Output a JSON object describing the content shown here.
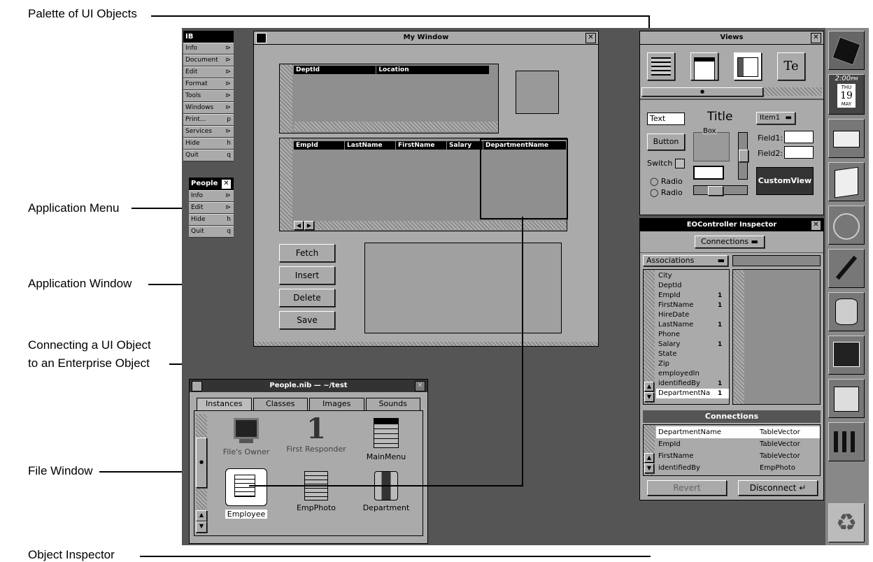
{
  "callouts": {
    "palette": "Palette of UI Objects",
    "app_menu": "Application Menu",
    "app_window": "Application Window",
    "connecting_line1": "Connecting a UI Object",
    "connecting_line2": "to an Enterprise Object",
    "file_window": "File Window",
    "object_inspector": "Object Inspector"
  },
  "ib_menu": {
    "title": "IB",
    "items": [
      {
        "label": "Info",
        "key": "⊳"
      },
      {
        "label": "Document",
        "key": "⊳"
      },
      {
        "label": "Edit",
        "key": "⊳"
      },
      {
        "label": "Format",
        "key": "⊳"
      },
      {
        "label": "Tools",
        "key": "⊳"
      },
      {
        "label": "Windows",
        "key": "⊳"
      },
      {
        "label": "Print...",
        "key": "p"
      },
      {
        "label": "Services",
        "key": "⊳"
      },
      {
        "label": "Hide",
        "key": "h"
      },
      {
        "label": "Quit",
        "key": "q"
      }
    ]
  },
  "people_menu": {
    "title": "People",
    "items": [
      {
        "label": "Info",
        "key": "⊳"
      },
      {
        "label": "Edit",
        "key": "⊳"
      },
      {
        "label": "Hide",
        "key": "h"
      },
      {
        "label": "Quit",
        "key": "q"
      }
    ]
  },
  "my_window": {
    "title": "My Window",
    "table1_cols": [
      "DeptId",
      "Location"
    ],
    "table2_cols": [
      "EmpId",
      "LastName",
      "FirstName",
      "Salary",
      "DepartmentName"
    ],
    "buttons": [
      "Fetch",
      "Insert",
      "Delete",
      "Save"
    ]
  },
  "views": {
    "title": "Views",
    "icon_text": "Te",
    "text_field": "Text",
    "title_label": "Title",
    "popup": "Item1",
    "box_label": "Box",
    "field1": "Field1:",
    "field2": "Field2:",
    "button": "Button",
    "switch": "Switch",
    "radio1": "Radio",
    "radio2": "Radio",
    "custom": "CustomView"
  },
  "inspector": {
    "title": "EOController Inspector",
    "mode": "Connections",
    "associations": "Associations",
    "keys": [
      {
        "name": "City",
        "count": ""
      },
      {
        "name": "DeptId",
        "count": ""
      },
      {
        "name": "EmpId",
        "count": "1"
      },
      {
        "name": "FirstName",
        "count": "1"
      },
      {
        "name": "HireDate",
        "count": ""
      },
      {
        "name": "LastName",
        "count": "1"
      },
      {
        "name": "Phone",
        "count": ""
      },
      {
        "name": "Salary",
        "count": "1"
      },
      {
        "name": "State",
        "count": ""
      },
      {
        "name": "Zip",
        "count": ""
      },
      {
        "name": "employedIn",
        "count": ""
      },
      {
        "name": "identifiedBy",
        "count": "1"
      },
      {
        "name": "DepartmentNa",
        "count": "1"
      }
    ],
    "connections_header": "Connections",
    "connections": [
      {
        "key": "DepartmentName",
        "target": "TableVector"
      },
      {
        "key": "EmpId",
        "target": "TableVector"
      },
      {
        "key": "FirstName",
        "target": "TableVector"
      },
      {
        "key": "identifiedBy",
        "target": "EmpPhoto"
      }
    ],
    "revert": "Revert",
    "disconnect": "Disconnect"
  },
  "file_window": {
    "title": "People.nib — ~/test",
    "tabs": [
      "Instances",
      "Classes",
      "Images",
      "Sounds"
    ],
    "icons": [
      {
        "label": "File's Owner",
        "icon": "monitor-icon"
      },
      {
        "label": "First Responder",
        "icon": "number-one-icon"
      },
      {
        "label": "MainMenu",
        "icon": "menu-icon"
      },
      {
        "label": "Employee",
        "icon": "table-icon"
      },
      {
        "label": "EmpPhoto",
        "icon": "table-icon"
      },
      {
        "label": "Department",
        "icon": "database-icon"
      }
    ]
  },
  "dock": {
    "clock_time": "2:00",
    "clock_ampm": "PM",
    "clock_day": "THU",
    "clock_date": "19",
    "clock_month": "MAY"
  }
}
